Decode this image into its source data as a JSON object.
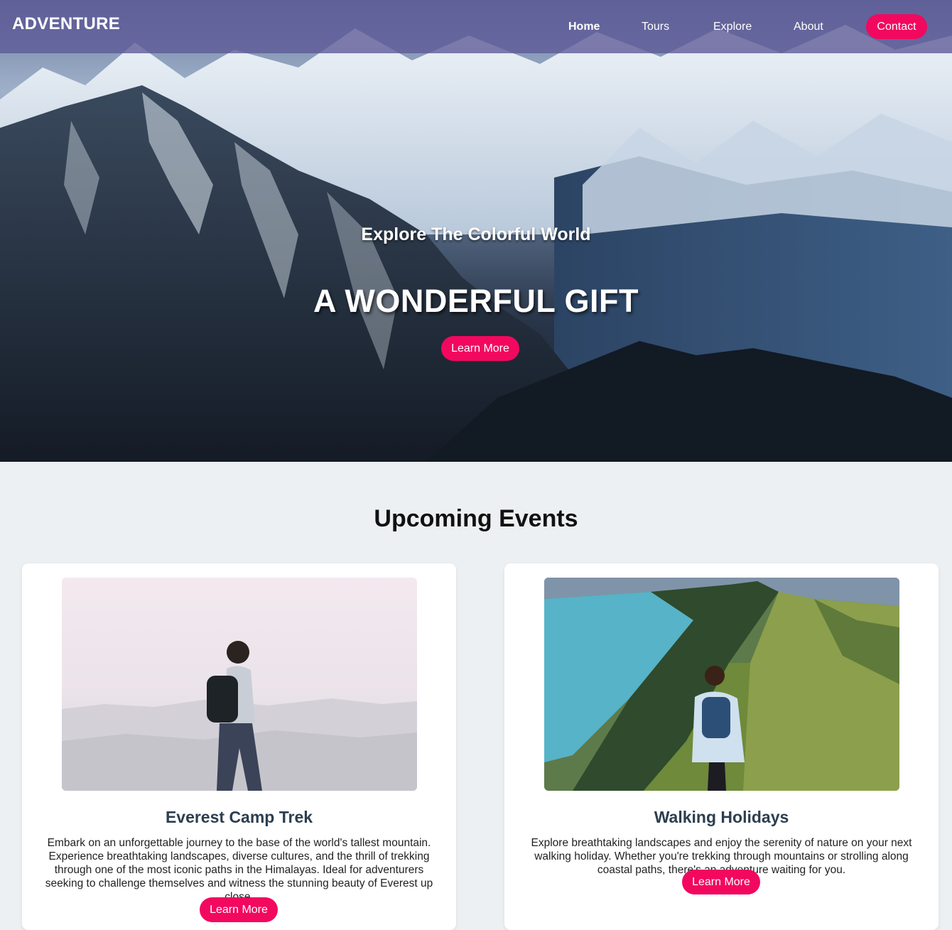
{
  "nav": {
    "brand": "ADVENTURE",
    "items": [
      "Home",
      "Tours",
      "Explore",
      "About"
    ],
    "contact_label": "Contact"
  },
  "hero": {
    "subtitle": "Explore The Colorful World",
    "title": "A WONDERFUL GIFT",
    "button_label": "Learn More"
  },
  "events": {
    "heading": "Upcoming Events",
    "cards": [
      {
        "title": "Everest Camp Trek",
        "description": "Embark on an unforgettable journey to the base of the world's tallest mountain. Experience breathtaking landscapes, diverse cultures, and the thrill of trekking through one of the most iconic paths in the Himalayas. Ideal for adventurers seeking to challenge themselves and witness the stunning beauty of Everest up close.",
        "button_label": "Learn More"
      },
      {
        "title": "Walking Holidays",
        "description": "Explore breathtaking landscapes and enjoy the serenity of nature on your next walking holiday. Whether you're trekking through mountains or strolling along coastal paths, there's an adventure waiting for you.",
        "button_label": "Learn More"
      }
    ]
  },
  "colors": {
    "accent": "#f2085f",
    "nav_bg": "#5c5896",
    "page_bg": "#edf0f2",
    "card_title": "#2c3e50"
  }
}
